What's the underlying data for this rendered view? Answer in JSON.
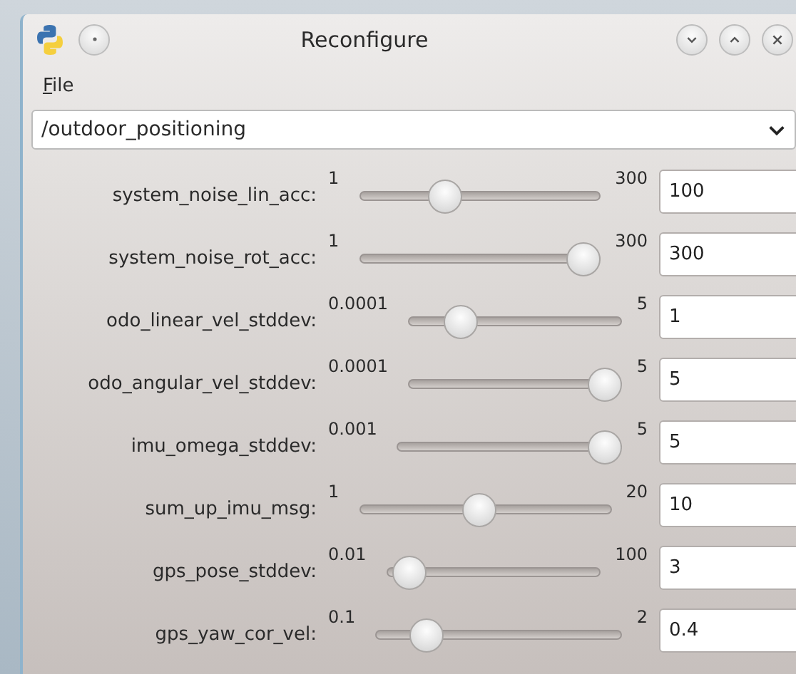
{
  "window": {
    "title": "Reconfigure"
  },
  "menu": [
    {
      "label": "File"
    }
  ],
  "node_selector": {
    "value": "/outdoor_positioning"
  },
  "parameters": [
    {
      "name": "system_noise_lin_acc:",
      "min": "1",
      "max": "300",
      "level": 0.33,
      "value": "100"
    },
    {
      "name": "system_noise_rot_acc:",
      "min": "1",
      "max": "300",
      "level": 1.0,
      "value": "300"
    },
    {
      "name": "odo_linear_vel_stddev:",
      "min": "0.0001",
      "max": "5",
      "level": 0.2,
      "value": "1"
    },
    {
      "name": "odo_angular_vel_stddev:",
      "min": "0.0001",
      "max": "5",
      "level": 1.0,
      "value": "5"
    },
    {
      "name": "imu_omega_stddev:",
      "min": "0.001",
      "max": "5",
      "level": 1.0,
      "value": "5"
    },
    {
      "name": "sum_up_imu_msg:",
      "min": "1",
      "max": "20",
      "level": 0.47,
      "value": "10"
    },
    {
      "name": "gps_pose_stddev:",
      "min": "0.01",
      "max": "100",
      "level": 0.03,
      "value": "3"
    },
    {
      "name": "gps_yaw_cor_vel:",
      "min": "0.1",
      "max": "2",
      "level": 0.16,
      "value": "0.4"
    }
  ]
}
